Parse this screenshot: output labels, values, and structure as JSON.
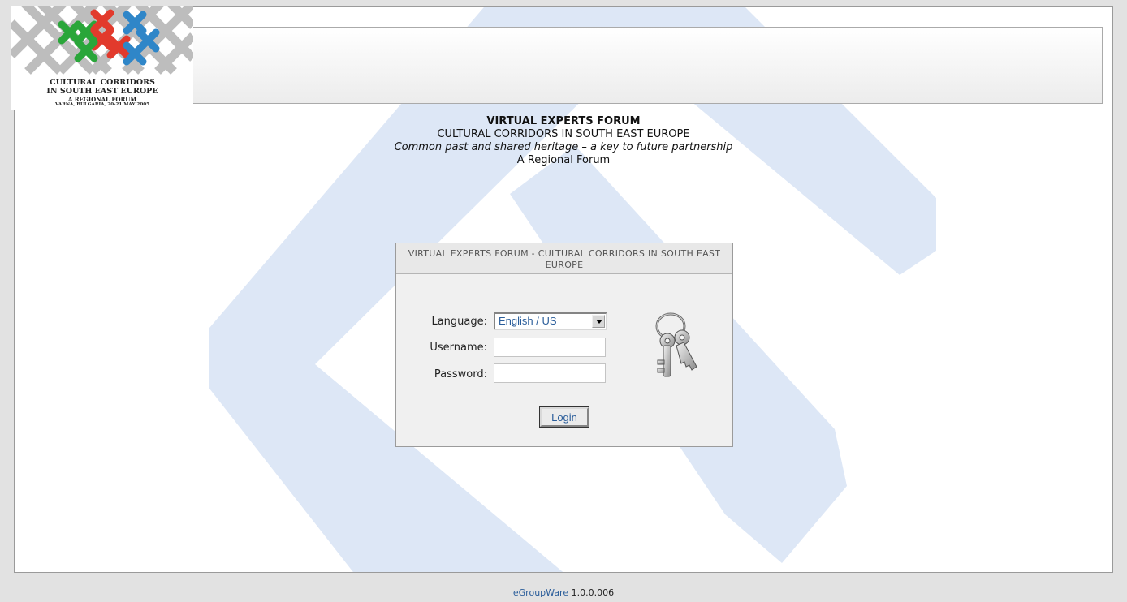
{
  "logo": {
    "line1": "CULTURAL CORRIDORS",
    "line2": "IN SOUTH EAST EUROPE",
    "line3": "A REGIONAL FORUM",
    "line4": "VARNA, BULGARIA, 20-21 MAY 2005",
    "colors": [
      "#2aa63a",
      "#e23a2c",
      "#2f86c8"
    ]
  },
  "intro": {
    "title": "VIRTUAL EXPERTS FORUM",
    "subtitle": "CULTURAL CORRIDORS IN SOUTH EAST EUROPE",
    "tagline": "Common past and shared heritage – a key to future partnership",
    "forum": "A Regional Forum"
  },
  "login": {
    "title": "VIRTUAL EXPERTS FORUM - CULTURAL CORRIDORS IN SOUTH EAST EUROPE",
    "language_label": "Language:",
    "language_value": "English / US",
    "username_label": "Username:",
    "username_value": "",
    "password_label": "Password:",
    "password_value": "",
    "button_label": "Login",
    "icon": "keys-icon"
  },
  "footer": {
    "app_name": "eGroupWare",
    "version": "1.0.0.006"
  },
  "colors": {
    "watermark": "#dbe6f6",
    "link": "#2a5d9a"
  }
}
